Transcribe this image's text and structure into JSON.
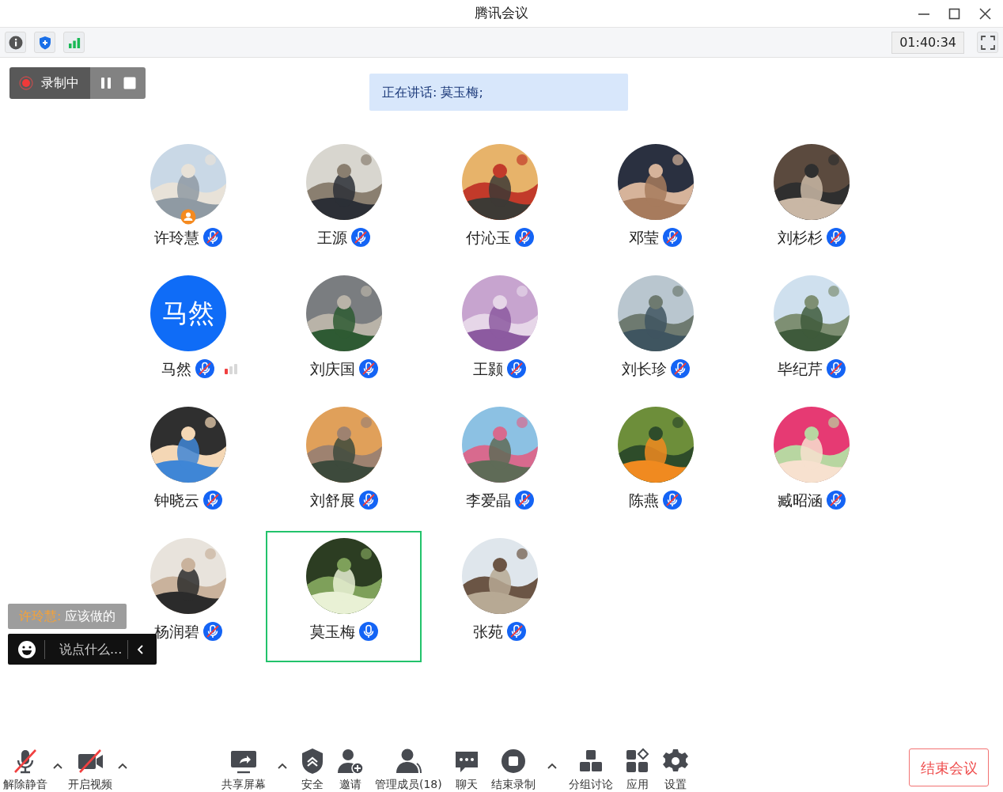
{
  "window": {
    "title": "腾讯会议"
  },
  "timer": "01:40:34",
  "recording": {
    "label": "录制中"
  },
  "speaking": "正在讲话: 莫玉梅;",
  "participants": [
    {
      "name": "许玲慧",
      "muted": true,
      "selected": false,
      "host": true,
      "weak_signal": false
    },
    {
      "name": "王源",
      "muted": true,
      "selected": false,
      "host": false,
      "weak_signal": false
    },
    {
      "name": "付沁玉",
      "muted": true,
      "selected": false,
      "host": false,
      "weak_signal": false
    },
    {
      "name": "邓莹",
      "muted": true,
      "selected": false,
      "host": false,
      "weak_signal": false
    },
    {
      "name": "刘杉杉",
      "muted": true,
      "selected": false,
      "host": false,
      "weak_signal": false
    },
    {
      "name": "马然",
      "muted": true,
      "selected": false,
      "host": false,
      "weak_signal": true,
      "avatar": {
        "kind": "initials",
        "text": "马然"
      }
    },
    {
      "name": "刘庆国",
      "muted": true,
      "selected": false,
      "host": false,
      "weak_signal": false
    },
    {
      "name": "王颢",
      "muted": true,
      "selected": false,
      "host": false,
      "weak_signal": false
    },
    {
      "name": "刘长珍",
      "muted": true,
      "selected": false,
      "host": false,
      "weak_signal": false
    },
    {
      "name": "毕纪芹",
      "muted": true,
      "selected": false,
      "host": false,
      "weak_signal": false
    },
    {
      "name": "钟晓云",
      "muted": true,
      "selected": false,
      "host": false,
      "weak_signal": false
    },
    {
      "name": "刘舒展",
      "muted": true,
      "selected": false,
      "host": false,
      "weak_signal": false
    },
    {
      "name": "李爱晶",
      "muted": true,
      "selected": false,
      "host": false,
      "weak_signal": false
    },
    {
      "name": "陈燕",
      "muted": true,
      "selected": false,
      "host": false,
      "weak_signal": false
    },
    {
      "name": "臧昭涵",
      "muted": true,
      "selected": false,
      "host": false,
      "weak_signal": false
    },
    {
      "name": "杨润碧",
      "muted": true,
      "selected": false,
      "host": false,
      "weak_signal": false
    },
    {
      "name": "莫玉梅",
      "muted": false,
      "selected": true,
      "host": false,
      "weak_signal": false
    },
    {
      "name": "张苑",
      "muted": true,
      "selected": false,
      "host": false,
      "weak_signal": false
    }
  ],
  "chat": {
    "sender": "许玲慧:",
    "message": "应该做的",
    "input": {
      "placeholder": "说点什么..."
    }
  },
  "toolbar_left": [
    {
      "kind": "mic",
      "label": "解除静音",
      "off": true,
      "menu": true
    },
    {
      "kind": "video",
      "label": "开启视频",
      "off": true,
      "menu": true
    }
  ],
  "toolbar_center": [
    {
      "kind": "share",
      "label": "共享屏幕",
      "off": false,
      "menu": true
    },
    {
      "kind": "security",
      "label": "安全",
      "off": false,
      "menu": false
    },
    {
      "kind": "invite",
      "label": "邀请",
      "off": false,
      "menu": false
    },
    {
      "kind": "members",
      "label": "管理成员(18)",
      "off": false,
      "menu": false
    },
    {
      "kind": "chat",
      "label": "聊天",
      "off": false,
      "menu": false
    },
    {
      "kind": "record",
      "label": "结束录制",
      "off": false,
      "menu": true
    },
    {
      "kind": "breakout",
      "label": "分组讨论",
      "off": false,
      "menu": false
    },
    {
      "kind": "apps",
      "label": "应用",
      "off": false,
      "menu": false
    },
    {
      "kind": "settings",
      "label": "设置",
      "off": false,
      "menu": false
    }
  ],
  "end_button": "结束会议"
}
